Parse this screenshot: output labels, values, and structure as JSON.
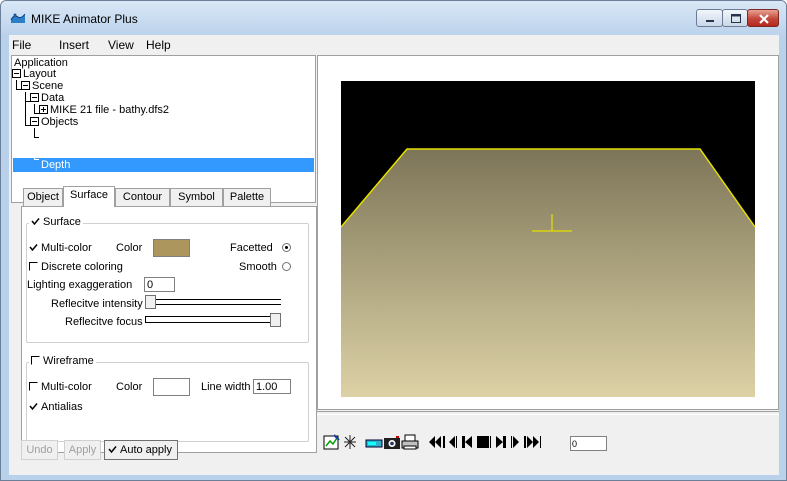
{
  "window": {
    "title": "MIKE Animator Plus",
    "buttons": [
      "minimize-icon",
      "maximize-icon",
      "close-icon"
    ]
  },
  "menu": {
    "items": [
      "File",
      "Insert",
      "View",
      "Help"
    ]
  },
  "tree": {
    "nodes": [
      {
        "label": "Application",
        "expander": "none"
      },
      {
        "label": "Layout",
        "expander": "minus"
      },
      {
        "label": "Scene",
        "expander": "minus"
      },
      {
        "label": "Data",
        "expander": "minus"
      },
      {
        "label": "MIKE 21 file - bathy.dfs2",
        "expander": "plus"
      },
      {
        "label": "Objects",
        "expander": "minus"
      },
      {
        "label": "Depth",
        "expander": "none",
        "selected": true
      }
    ]
  },
  "tabs": {
    "items": [
      "Object",
      "Surface",
      "Contour",
      "Symbol",
      "Palette"
    ],
    "active": "Surface"
  },
  "surface": {
    "legend": "Surface",
    "legend_checked": true,
    "multicolor_label": "Multi-color",
    "multicolor_checked": true,
    "color_label": "Color",
    "color_value": "#ad965e",
    "faceted_label": "Facetted",
    "faceted_selected": true,
    "discrete_label": "Discrete coloring",
    "discrete_checked": false,
    "smooth_label": "Smooth",
    "smooth_selected": false,
    "lighting_label": "Lighting exaggeration",
    "lighting_value": "0",
    "reflective_intensity_label": "Reflecitve intensity",
    "reflective_intensity_level": 0.0,
    "reflective_focus_label": "Reflecitve focus",
    "reflective_focus_level": 1.0
  },
  "wireframe": {
    "legend": "Wireframe",
    "legend_checked": false,
    "multicolor_label": "Multi-color",
    "multicolor_checked": false,
    "color_label": "Color",
    "color_value": "#ffffff",
    "linewidth_label": "Line width",
    "linewidth_value": "1.00",
    "antialias_label": "Antialias",
    "antialias_checked": true
  },
  "actions": {
    "undo": "Undo",
    "apply": "Apply",
    "auto_apply": "Auto apply",
    "auto_apply_checked": true
  },
  "viewer": {
    "background": "#000000",
    "surface_top": "#7d7558",
    "surface_bottom": "#ddd2a6",
    "edge_color": "#e6e000"
  },
  "playback": {
    "tools": [
      "chart-icon",
      "asterisk-icon",
      "camera-icon",
      "snapshot-icon",
      "print-icon",
      "rewind-icon",
      "step-back-icon",
      "first-frame-icon",
      "stop-icon",
      "last-frame-icon",
      "step-forward-icon",
      "fast-forward-icon"
    ],
    "frame": "0"
  }
}
